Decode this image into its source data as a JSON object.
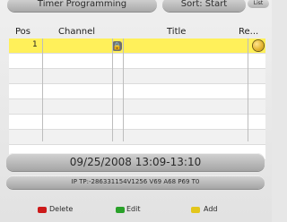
{
  "top": {
    "title": "Timer Programming",
    "sort": "Sort: Start",
    "list": "List"
  },
  "table": {
    "columns": [
      "Pos",
      "Channel",
      "Title",
      "Re..."
    ],
    "rows": [
      {
        "pos": "1",
        "channel": "",
        "title": "",
        "locked": true,
        "recording": true
      },
      {
        "pos": "",
        "channel": "",
        "title": ""
      },
      {
        "pos": "",
        "channel": "",
        "title": ""
      },
      {
        "pos": "",
        "channel": "",
        "title": ""
      },
      {
        "pos": "",
        "channel": "",
        "title": ""
      },
      {
        "pos": "",
        "channel": "",
        "title": ""
      },
      {
        "pos": "",
        "channel": "",
        "title": ""
      },
      {
        "pos": "",
        "channel": "",
        "title": ""
      }
    ]
  },
  "info": {
    "date_time": "09/25/2008 13:09-13:10",
    "ip_tp": "IP TP:-286331154V1256 V69 A68 P69 T0"
  },
  "legend": {
    "delete": "Delete",
    "edit": "Edit",
    "add": "Add"
  },
  "colors": {
    "selected_row": "#fff05a",
    "red_key": "#cc1a1a",
    "green_key": "#2aa12a",
    "yellow_key": "#e3c61b"
  }
}
